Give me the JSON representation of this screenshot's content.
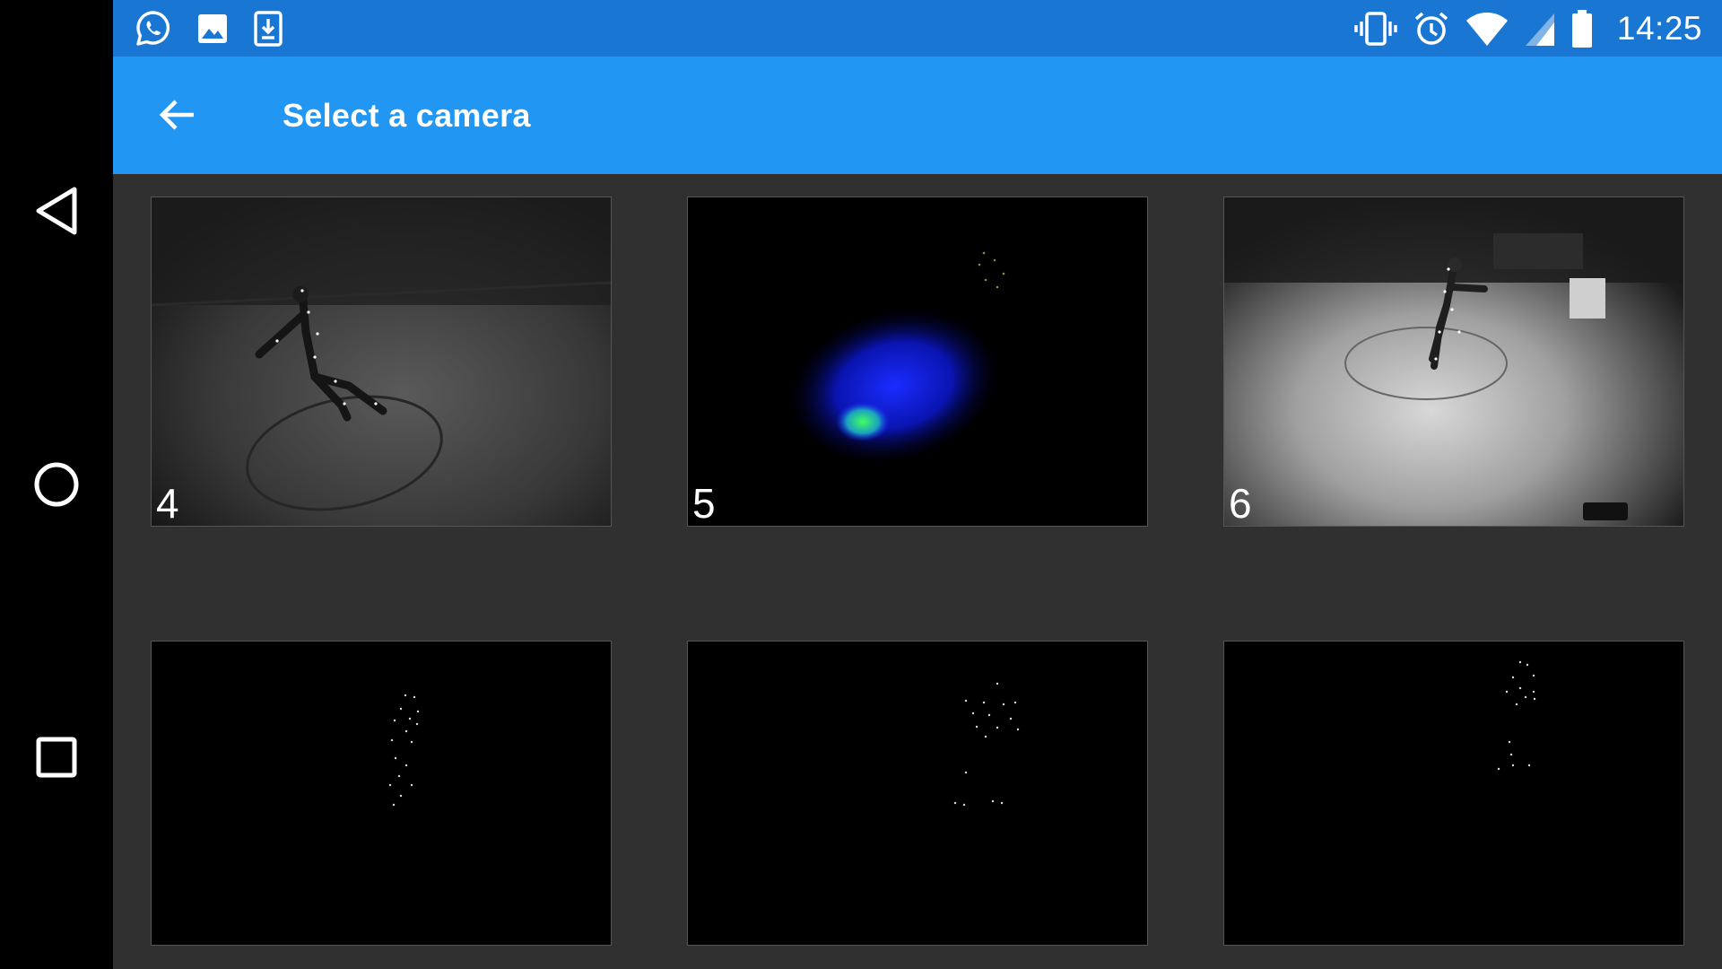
{
  "status_bar": {
    "time": "14:25",
    "left_icons": [
      "whatsapp-icon",
      "gallery-icon",
      "download-icon"
    ],
    "right_icons": [
      "vibrate-icon",
      "alarm-icon",
      "wifi-icon",
      "cellular-icon",
      "battery-icon"
    ],
    "background": "#1976D2"
  },
  "app_bar": {
    "title": "Select a camera",
    "back_icon": "arrow-back-icon",
    "background": "#2196F3"
  },
  "nav_bar": {
    "buttons": [
      "back-triangle-icon",
      "home-circle-icon",
      "recents-square-icon"
    ]
  },
  "cameras": [
    {
      "label": "4",
      "view": "grayscale-dark"
    },
    {
      "label": "5",
      "view": "intensity-blue"
    },
    {
      "label": "6",
      "view": "grayscale-bright"
    },
    {
      "label": "",
      "view": "markers"
    },
    {
      "label": "",
      "view": "markers"
    },
    {
      "label": "",
      "view": "markers"
    }
  ]
}
